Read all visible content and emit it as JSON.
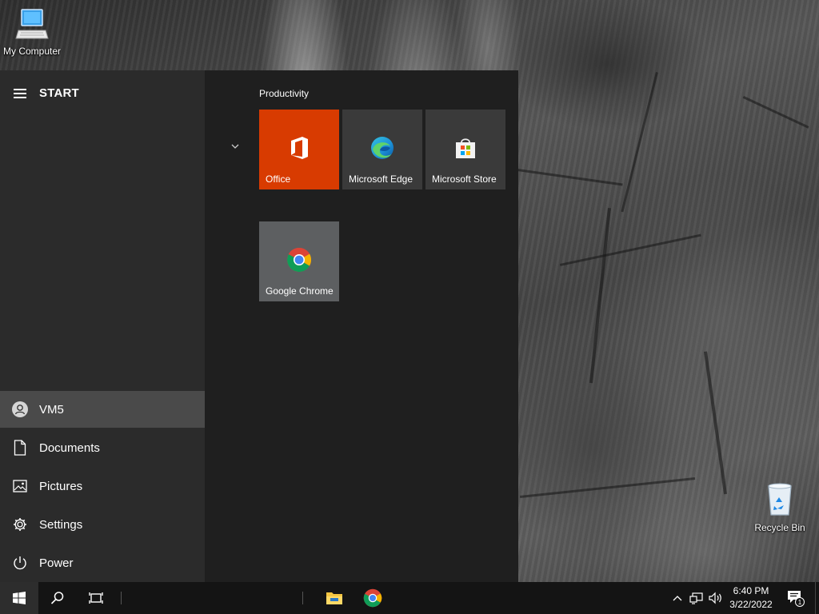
{
  "desktop": {
    "icons": [
      {
        "label": "My Computer",
        "icon": "computer-icon"
      },
      {
        "label": "Recycle Bin",
        "icon": "recycle-bin-icon"
      }
    ]
  },
  "start_menu": {
    "title": "START",
    "nav": [
      {
        "label": "VM5",
        "icon": "user-avatar-icon",
        "active": true
      },
      {
        "label": "Documents",
        "icon": "document-icon"
      },
      {
        "label": "Pictures",
        "icon": "pictures-icon"
      },
      {
        "label": "Settings",
        "icon": "gear-icon"
      },
      {
        "label": "Power",
        "icon": "power-icon"
      }
    ],
    "group_title": "Productivity",
    "tiles": [
      {
        "label": "Office",
        "icon": "office-icon",
        "color": "#d83b01"
      },
      {
        "label": "Microsoft Edge",
        "icon": "edge-icon",
        "color": "#3a3a3a"
      },
      {
        "label": "Microsoft Store",
        "icon": "store-icon",
        "color": "#3a3a3a"
      },
      {
        "label": "Google Chrome",
        "icon": "chrome-icon",
        "color": "#5d5f61"
      }
    ]
  },
  "taskbar": {
    "buttons": [
      "windows-start-icon",
      "search-icon",
      "task-view-icon",
      "file-explorer-icon",
      "chrome-icon"
    ],
    "clock": {
      "time": "6:40 PM",
      "date": "3/22/2022"
    },
    "notifications_count": "1"
  }
}
